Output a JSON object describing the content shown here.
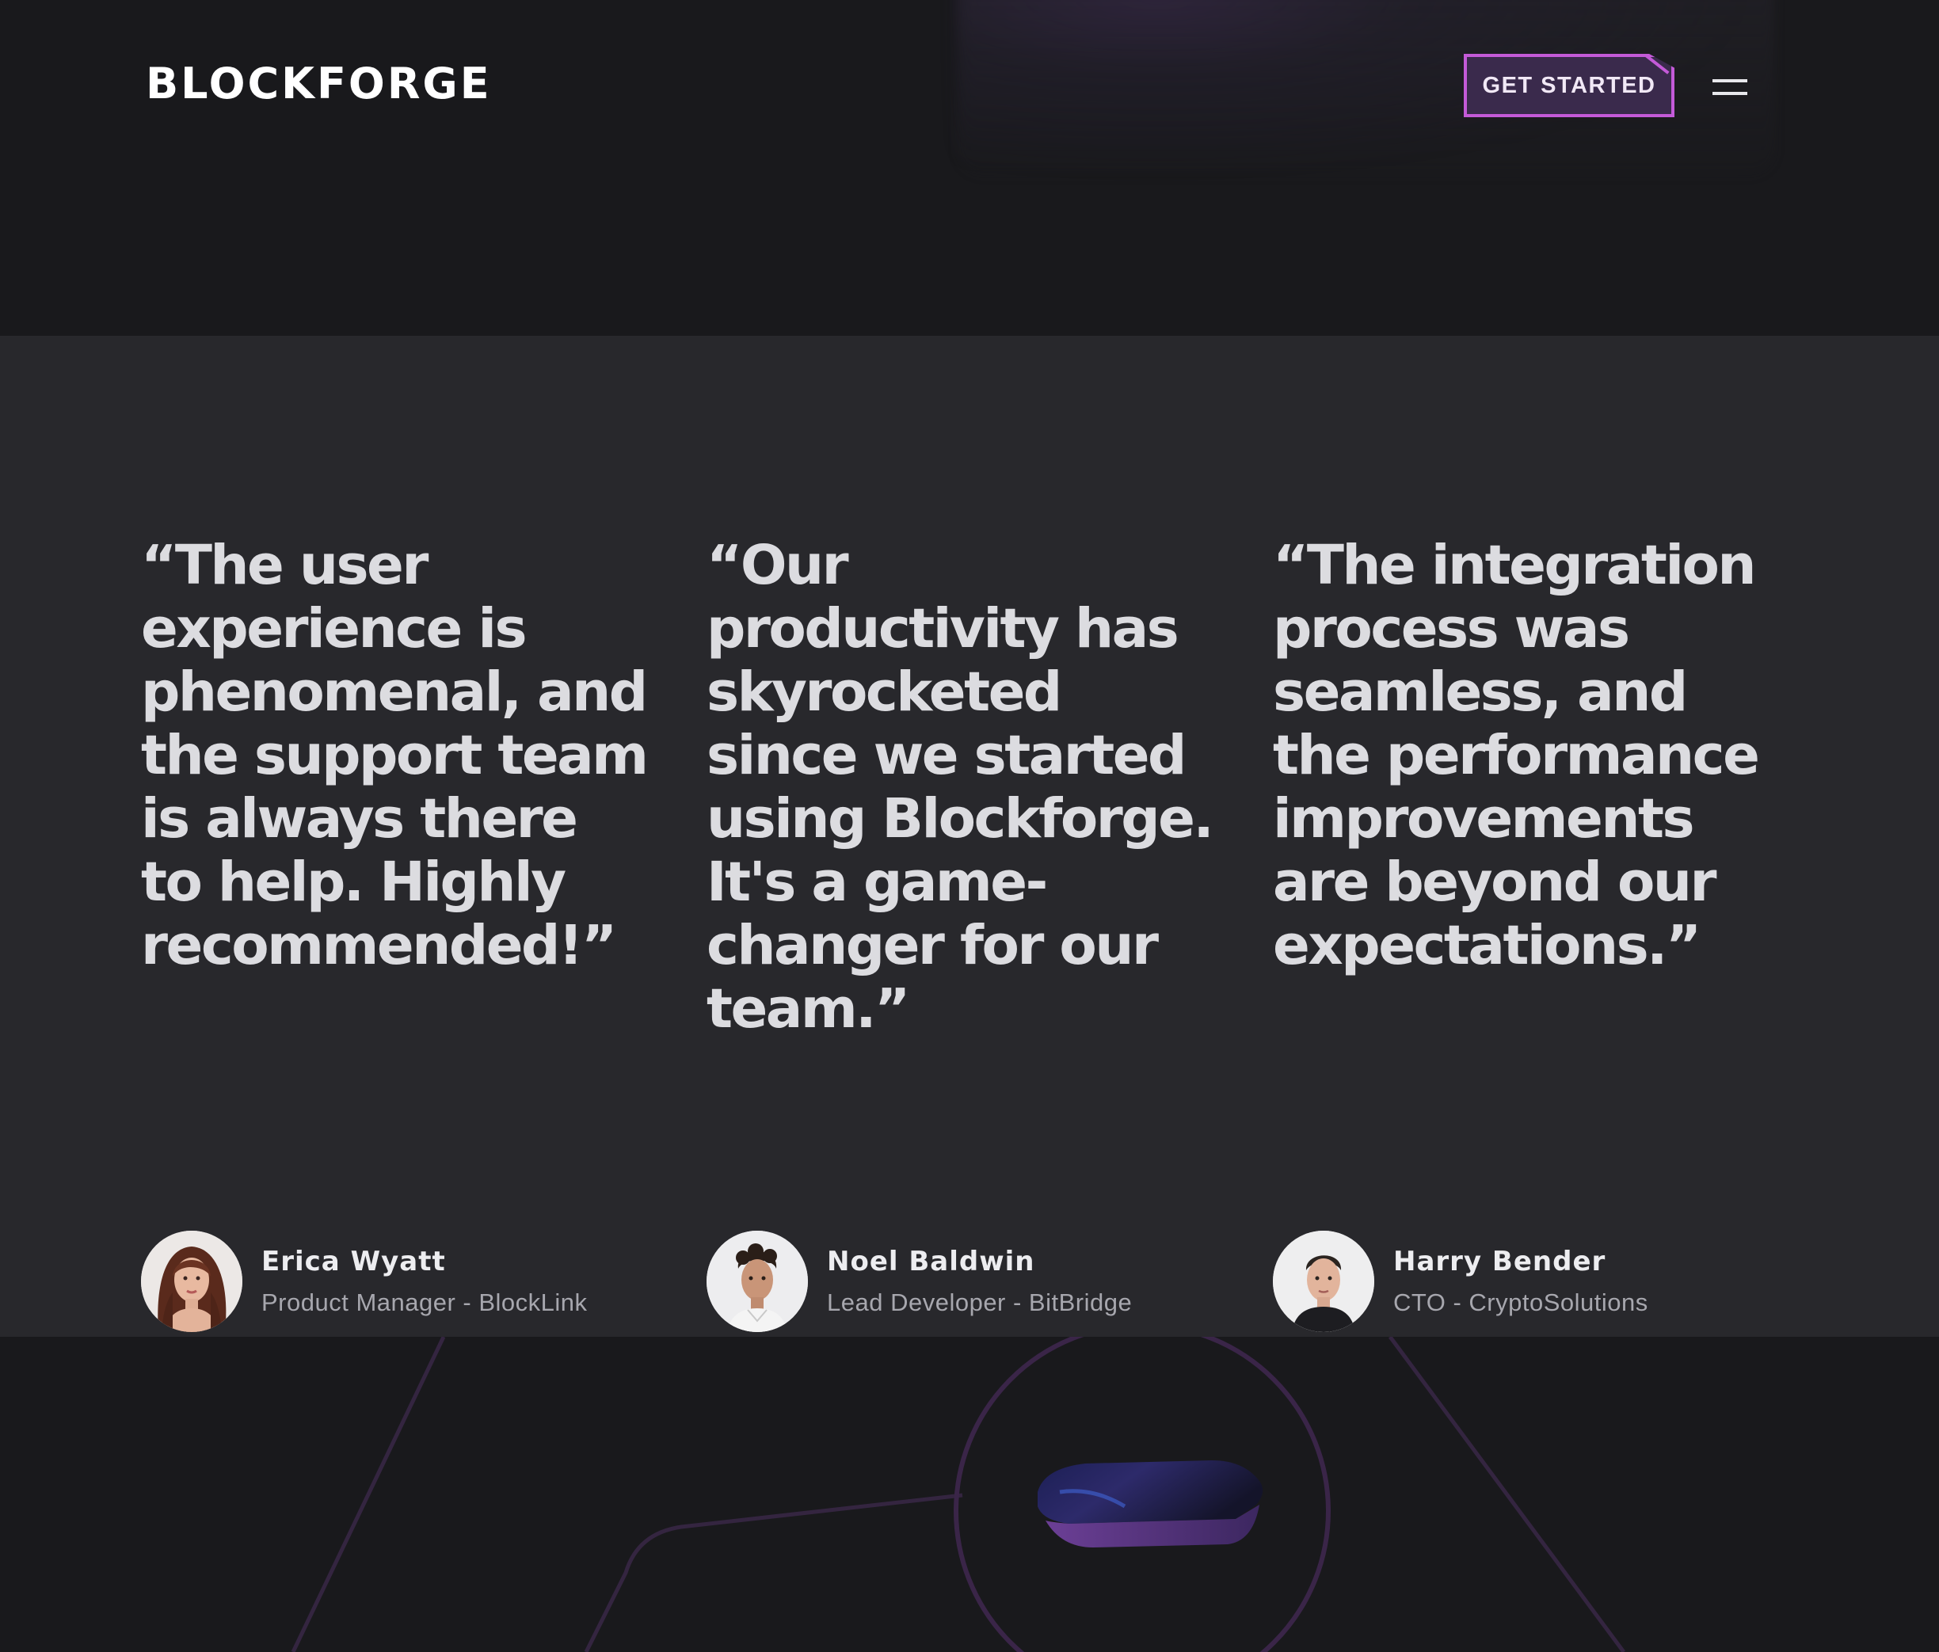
{
  "header": {
    "logo": "BLOCKFORGE",
    "cta_label": "GET STARTED",
    "menu_icon": "menu-icon"
  },
  "colors": {
    "background": "#19191c",
    "section": "#28282c",
    "accent": "#c45ad8",
    "cta_fill": "#3a2a4c"
  },
  "testimonials": [
    {
      "quote": "“The user experience is phenomenal, and the support team is always there to help. Highly recommended!”",
      "name": "Erica Wyatt",
      "role": "Product Manager - BlockLink",
      "avatar": "avatar-woman-icon"
    },
    {
      "quote": "“Our productivity has skyrocketed since we started using Blockforge. It's a game-changer for our team.”",
      "name": "Noel Baldwin",
      "role": "Lead Developer - BitBridge",
      "avatar": "avatar-man-curly-hair-icon"
    },
    {
      "quote": "“The integration process was seamless, and the performance improvements are beyond our expectations.”",
      "name": "Harry Bender",
      "role": "CTO - CryptoSolutions",
      "avatar": "avatar-man-dark-shirt-icon"
    }
  ]
}
